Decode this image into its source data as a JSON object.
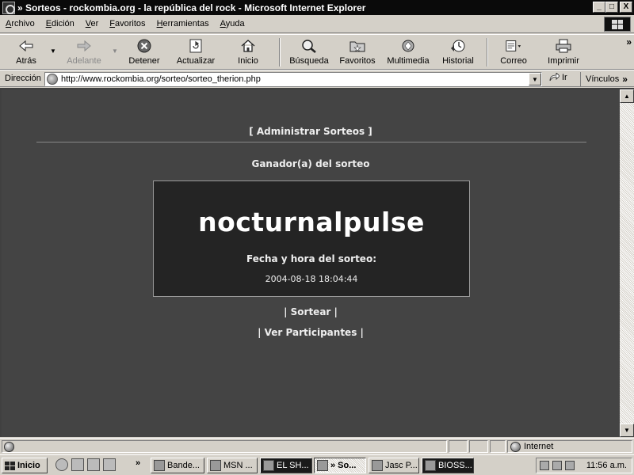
{
  "window": {
    "title": "» Sorteos - rockombia.org - la república del rock - Microsoft Internet Explorer",
    "min": "_",
    "max": "□",
    "close": "X"
  },
  "menu": [
    "Archivo",
    "Edición",
    "Ver",
    "Favoritos",
    "Herramientas",
    "Ayuda"
  ],
  "toolbar": {
    "back": "Atrás",
    "forward": "Adelante",
    "stop": "Detener",
    "refresh": "Actualizar",
    "home": "Inicio",
    "search": "Búsqueda",
    "favorites": "Favoritos",
    "media": "Multimedia",
    "history": "Historial",
    "mail": "Correo",
    "print": "Imprimir",
    "more": "»"
  },
  "address": {
    "label": "Dirección",
    "url": "http://www.rockombia.org/sorteo/sorteo_therion.php",
    "go": "Ir",
    "links": "Vínculos",
    "links_more": "»"
  },
  "page": {
    "admin_link": "[ Administrar Sorteos ]",
    "winner_label": "Ganador(a) del sorteo",
    "winner_name": "nocturnalpulse",
    "draw_label": "Fecha y hora del sorteo:",
    "draw_date": "2004-08-18 18:04:44",
    "draw_link": "| Sortear |",
    "participants_link": "| Ver Participantes |"
  },
  "status": {
    "zone": "Internet"
  },
  "taskbar": {
    "start": "Inicio",
    "quick_more": "»",
    "tasks": [
      "Bande...",
      "MSN ...",
      "EL SH...",
      "» So...",
      "Jasc P...",
      "BIOSS..."
    ],
    "clock": "11:56 a.m."
  }
}
